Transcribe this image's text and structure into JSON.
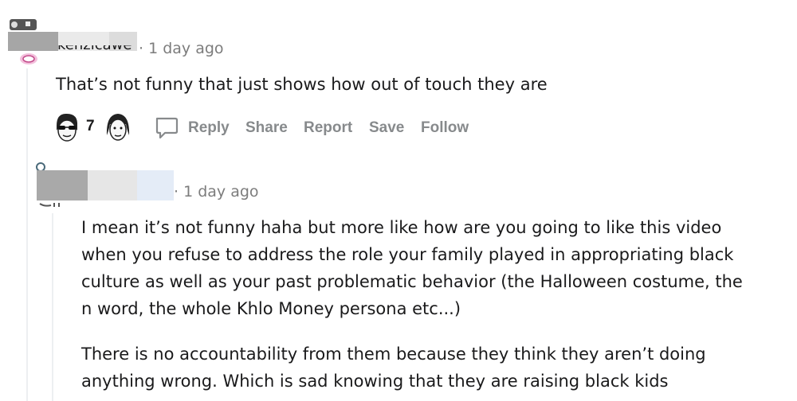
{
  "comment1": {
    "username_partial": "kenzicawe",
    "separator": "·",
    "timestamp": "1 day ago",
    "body": "That’s not funny that just shows how out of touch they are",
    "award_count": "7",
    "actions": {
      "reply": "Reply",
      "share": "Share",
      "report": "Report",
      "save": "Save",
      "follow": "Follow"
    }
  },
  "comment2": {
    "separator": "·",
    "timestamp": "1 day ago",
    "paragraphs": [
      [
        "I mean it’s not funny haha but more like how are you going to like this video",
        "when you refuse to address the role your family played in appropriating black",
        "culture as well as your past problematic behavior (the Halloween costume, the",
        "n word, the whole Khlo Money persona etc...)"
      ],
      [
        "There is no accountability from them because they think they aren’t doing",
        "anything wrong. Which is sad knowing that they are raising black kids"
      ]
    ]
  },
  "colors": {
    "thread_line": "#edeff1",
    "meta_text": "#7c7c7c",
    "action_text": "#878a8c",
    "body_text": "#1a1a1b"
  }
}
